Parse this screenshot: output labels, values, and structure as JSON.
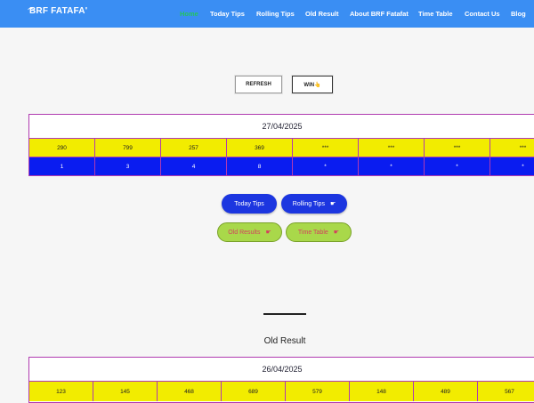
{
  "header": {
    "logo_text": "BRF FATAFA'",
    "logo_tagline": "",
    "nav": [
      "Home",
      "Today Tips",
      "Rolling Tips",
      "Old Result",
      "About BRF Fatafat",
      "Time Table",
      "Contact Us",
      "Blog"
    ],
    "active_index": 0
  },
  "buttons": {
    "refresh": "REFRESH",
    "win": "WIN👆"
  },
  "current": {
    "date": "27/04/2025",
    "top_row": [
      "290",
      "799",
      "257",
      "369",
      "***",
      "***",
      "***",
      "***"
    ],
    "bottom_row": [
      "1",
      "3",
      "4",
      "8",
      "*",
      "*",
      "*",
      "*"
    ]
  },
  "links": {
    "today_tips": "Today Tips",
    "rolling_tips": "Rolling Tips",
    "old_results": "Old Results",
    "time_table": "Time Table"
  },
  "old_result": {
    "title": "Old Result",
    "date": "26/04/2025",
    "top_row": [
      "123",
      "145",
      "468",
      "689",
      "579",
      "148",
      "489",
      "567"
    ]
  },
  "colors": {
    "header_bg": "#3a8ef3",
    "table_border": "#b03ab0",
    "yellow_row": "#f2ec00",
    "blue_row": "#0a1cf0",
    "pill_blue": "#1c36e0",
    "pill_green": "#a9d84a"
  }
}
